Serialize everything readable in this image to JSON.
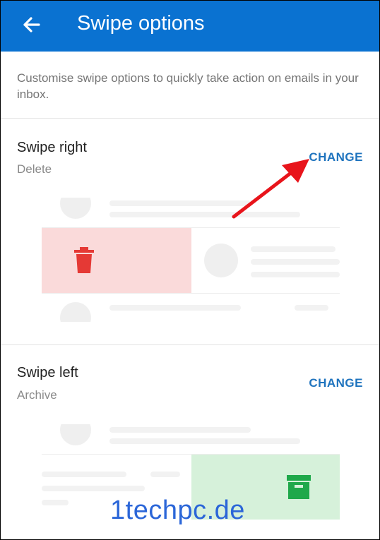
{
  "header": {
    "title": "Swipe options",
    "back_icon": "arrow-left-icon"
  },
  "intro": {
    "text": "Customise swipe options to quickly take action on emails in your inbox."
  },
  "swipe_right": {
    "title": "Swipe right",
    "action": "Delete",
    "change_label": "CHANGE",
    "action_icon": "trash-icon",
    "color": "#e53935",
    "bg": "#fadada"
  },
  "swipe_left": {
    "title": "Swipe left",
    "action": "Archive",
    "change_label": "CHANGE",
    "action_icon": "archive-icon",
    "color": "#1fa84a",
    "bg": "#d6f1da"
  },
  "annotation": {
    "arrow_color": "#e8141b"
  },
  "watermark": {
    "text": "1techpc.de"
  }
}
